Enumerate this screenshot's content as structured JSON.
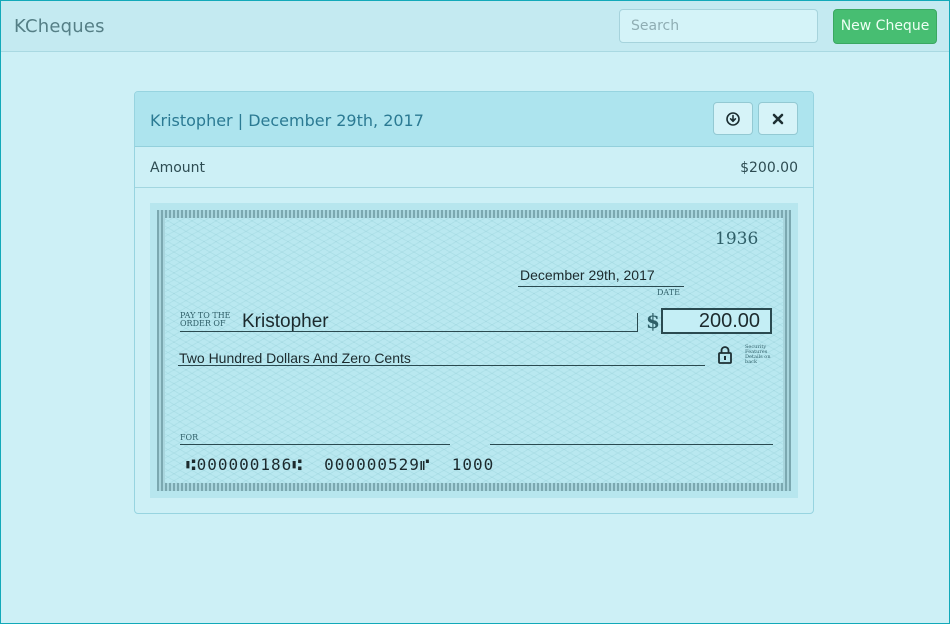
{
  "app": {
    "title": "KCheques"
  },
  "header": {
    "search_placeholder": "Search",
    "new_button_label": "New Cheque"
  },
  "panel": {
    "title": "Kristopher | December 29th, 2017",
    "download_icon": "download-circle-icon",
    "close_icon": "close-x-icon",
    "amount_label": "Amount",
    "amount_value": "$200.00"
  },
  "cheque": {
    "number": "1936",
    "date": "December 29th, 2017",
    "date_caption": "DATE",
    "payto_caption_1": "PAY TO THE",
    "payto_caption_2": "ORDER OF",
    "payee": "Kristopher",
    "dollar_sign": "$",
    "amount": "200.00",
    "amount_words": "Two Hundred Dollars And Zero Cents",
    "security_note_1": "Security",
    "security_note_2": "Features",
    "security_note_3": "Details on",
    "security_note_4": "back",
    "for_caption": "FOR",
    "micr_routing": "⑆000000186⑆",
    "micr_account": "000000529⑈",
    "micr_check": "1000"
  },
  "colors": {
    "page_bg": "#cdf0f6",
    "accent_green": "#47be72",
    "title_blue": "#2b7a93",
    "cheque_bg": "#b9e8f0"
  }
}
